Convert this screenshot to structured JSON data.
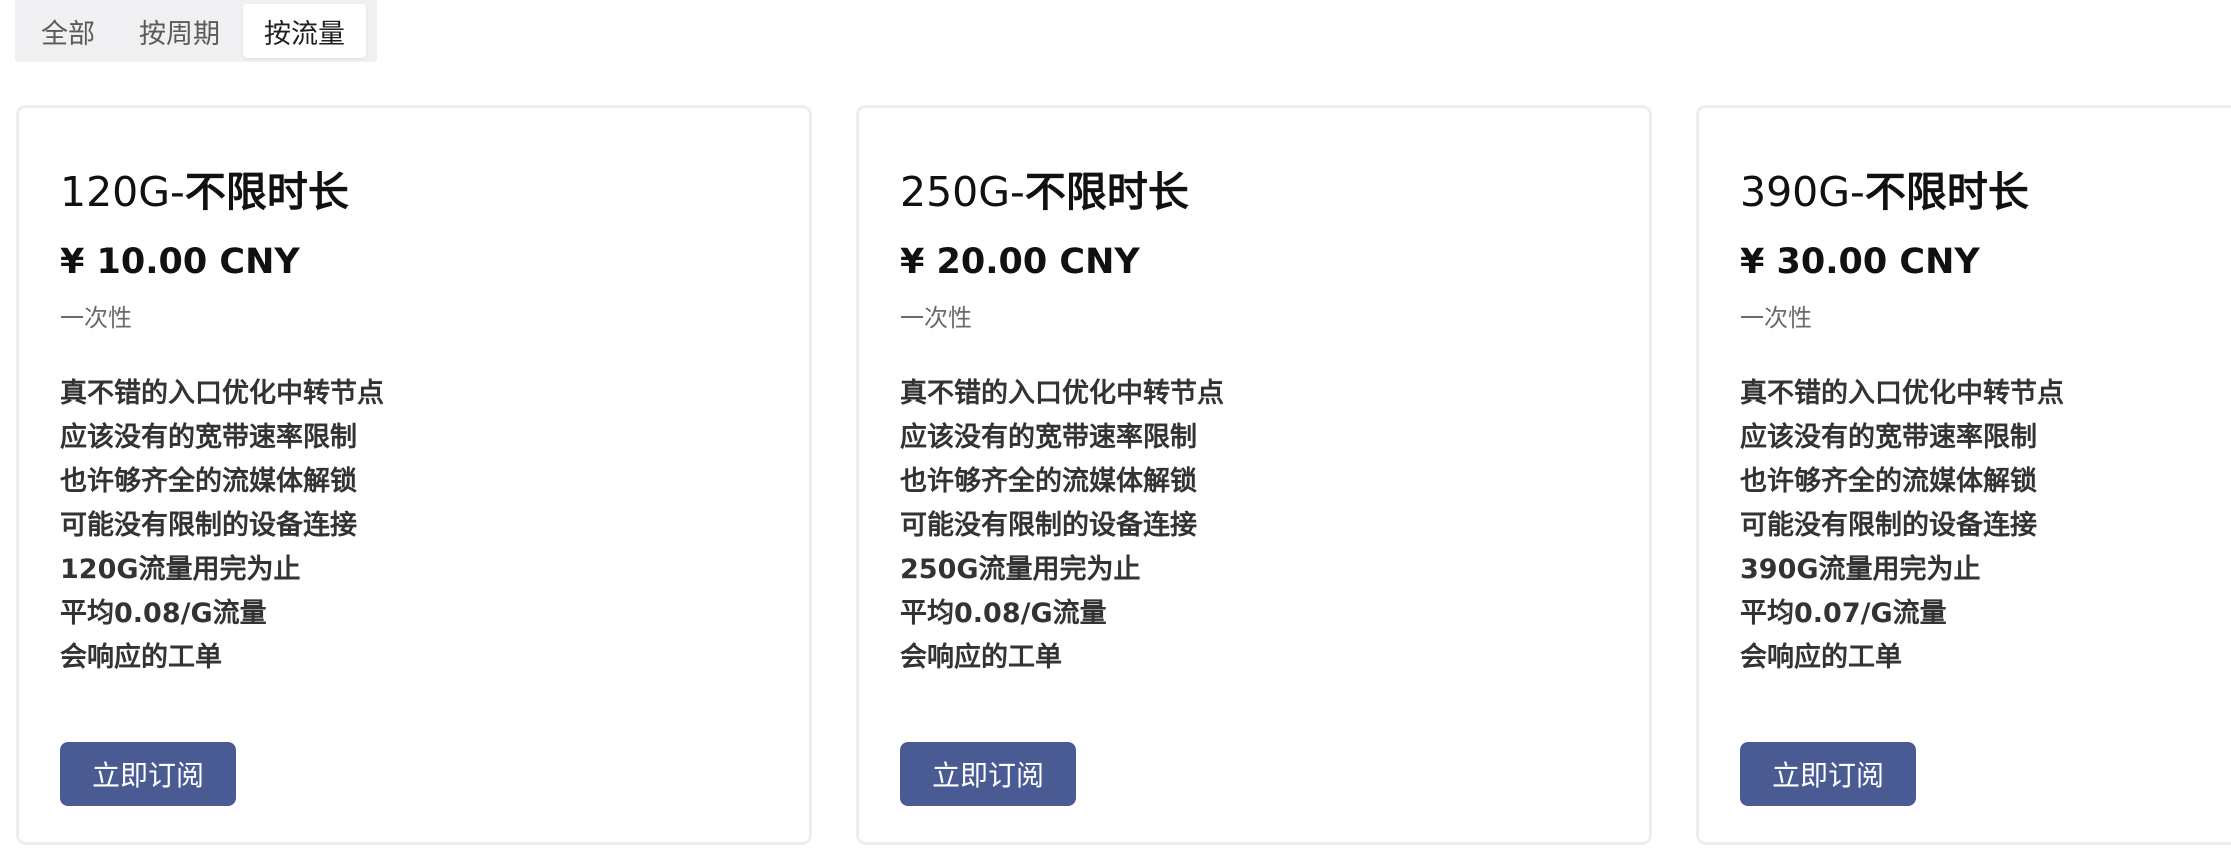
{
  "tabs": [
    {
      "label": "全部",
      "active": false
    },
    {
      "label": "按周期",
      "active": false
    },
    {
      "label": "按流量",
      "active": true
    }
  ],
  "colors": {
    "accent": "#4a5b94",
    "tab_bg": "#f0f0f2",
    "card_border": "#eeeeee"
  },
  "plans": [
    {
      "title_prefix": "120G-",
      "title_suffix": "不限时长",
      "price": "¥ 10.00 CNY",
      "period": "一次性",
      "features": [
        "真不错的入口优化中转节点",
        "应该没有的宽带速率限制",
        "也许够齐全的流媒体解锁",
        "可能没有限制的设备连接",
        "120G流量用完为止",
        "平均0.08/G流量",
        "会响应的工单"
      ],
      "button": "立即订阅"
    },
    {
      "title_prefix": "250G-",
      "title_suffix": "不限时长",
      "price": "¥ 20.00 CNY",
      "period": "一次性",
      "features": [
        "真不错的入口优化中转节点",
        "应该没有的宽带速率限制",
        "也许够齐全的流媒体解锁",
        "可能没有限制的设备连接",
        "250G流量用完为止",
        "平均0.08/G流量",
        "会响应的工单"
      ],
      "button": "立即订阅"
    },
    {
      "title_prefix": "390G-",
      "title_suffix": "不限时长",
      "price": "¥ 30.00 CNY",
      "period": "一次性",
      "features": [
        "真不错的入口优化中转节点",
        "应该没有的宽带速率限制",
        "也许够齐全的流媒体解锁",
        "可能没有限制的设备连接",
        "390G流量用完为止",
        "平均0.07/G流量",
        "会响应的工单"
      ],
      "button": "立即订阅"
    }
  ]
}
